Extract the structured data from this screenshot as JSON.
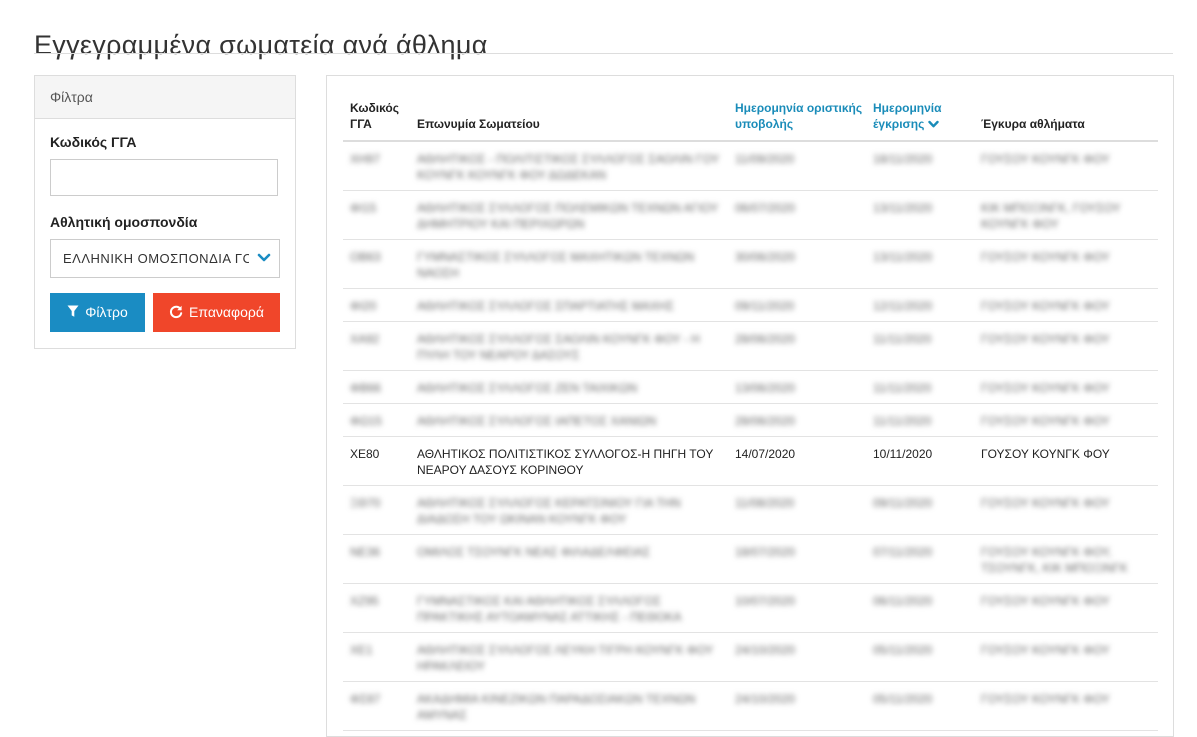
{
  "page": {
    "title": "Εγγεγραμμένα σωματεία ανά άθλημα"
  },
  "filters": {
    "panel_title": "Φίλτρα",
    "gga_code_label": "Κωδικός ΓΓΑ",
    "gga_code_value": "",
    "federation_label": "Αθλητική ομοσπονδία",
    "federation_selected": "ΕΛΛΗΝΙΚΗ ΟΜΟΣΠΟΝΔΙΑ ΓΟΥΣΟΥ",
    "filter_button": "Φίλτρο",
    "reset_button": "Επαναφορά",
    "filter_button_color": "#1a8cc3",
    "reset_button_color": "#f0462a",
    "icons": {
      "filter": "funnel-icon",
      "reset": "refresh-icon",
      "select": "chevron-down-icon"
    }
  },
  "table": {
    "headers": {
      "code": "Κωδικός ΓΓΑ",
      "name": "Επωνυμία Σωματείου",
      "submission_date": "Ημερομηνία οριστικής υποβολής",
      "approval_date": "Ημερομηνία έγκρισης",
      "valid_sports": "Έγκυρα αθλήματα"
    },
    "sorted_by": "approval_date",
    "sort_direction": "descending",
    "link_color": "#1a8cb9",
    "rows": [
      {
        "code": "ΧΗ97",
        "name": "ΑΘΛΗΤΙΚΟΣ - ΠΟΛΙΤΙΣΤΙΚΟΣ ΣΥΛΛΟΓΟΣ ΣΑΟΛΙΝ ΓΟΥ ΚΟΥΝΓΚ ΚΟΥΝΓΚ ΦΟΥ ΔΩΔΕΚΑΝ",
        "submitted": "11/09/2020",
        "approved": "18/11/2020",
        "sports": "ΓΟΥΣΟΥ ΚΟΥΝΓΚ ΦΟΥ",
        "blurred": true,
        "lines": 2
      },
      {
        "code": "ΦΙ15",
        "name": "ΑΘΛΗΤΙΚΟΣ ΣΥΛΛΟΓΟΣ ΠΟΛΕΜΙΚΩΝ ΤΕΧΝΩΝ ΑΓΙΟΥ ΔΗΜΗΤΡΙΟΥ ΚΑΙ ΠΕΡΙΧΩΡΩΝ",
        "submitted": "06/07/2020",
        "approved": "13/11/2020",
        "sports": "ΚΙΚ ΜΠΟΞΙΝΓΚ, ΓΟΥΣΟΥ ΚΟΥΝΓΚ ΦΟΥ",
        "blurred": true,
        "lines": 2
      },
      {
        "code": "ΟΒ63",
        "name": "ΓΥΜΝΑΣΤΙΚΟΣ ΣΥΛΛΟΓΟΣ ΜΑΧΗΤΙΚΩΝ ΤΕΧΝΩΝ ΝΑΟΣΗ",
        "submitted": "30/06/2020",
        "approved": "13/11/2020",
        "sports": "ΓΟΥΣΟΥ ΚΟΥΝΓΚ ΦΟΥ",
        "blurred": true,
        "lines": 2
      },
      {
        "code": "ΦΙ20",
        "name": "ΑΘΛΗΤΙΚΟΣ ΣΥΛΛΟΓΟΣ ΣΠΑΡΤΙΑΤΗΣ ΜΑΧΗΣ",
        "submitted": "09/11/2020",
        "approved": "12/11/2020",
        "sports": "ΓΟΥΣΟΥ ΚΟΥΝΓΚ ΦΟΥ",
        "blurred": true,
        "lines": 1
      },
      {
        "code": "ΧΑ92",
        "name": "ΑΘΛΗΤΙΚΟΣ ΣΥΛΛΟΓΟΣ ΣΑΟΛΙΝ ΚΟΥΝΓΚ ΦΟΥ - Η ΠΥΛΗ ΤΟΥ ΝΕΑΡΟΥ ΔΑΣΟΥΣ",
        "submitted": "28/06/2020",
        "approved": "11/11/2020",
        "sports": "ΓΟΥΣΟΥ ΚΟΥΝΓΚ ΦΟΥ",
        "blurred": true,
        "lines": 2
      },
      {
        "code": "ΦΒ66",
        "name": "ΑΘΛΗΤΙΚΟΣ ΣΥΛΛΟΓΟΣ ΖΕΝ ΤΑΙΧΙΚΩΝ",
        "submitted": "13/06/2020",
        "approved": "11/11/2020",
        "sports": "ΓΟΥΣΟΥ ΚΟΥΝΓΚ ΦΟΥ",
        "blurred": true,
        "lines": 1
      },
      {
        "code": "ΦΩ15",
        "name": "ΑΘΛΗΤΙΚΟΣ ΣΥΛΛΟΓΟΣ ΙΑΠΕΤΟΣ ΧΑΝΙΩΝ",
        "submitted": "28/06/2020",
        "approved": "11/11/2020",
        "sports": "ΓΟΥΣΟΥ ΚΟΥΝΓΚ ΦΟΥ",
        "blurred": true,
        "lines": 1
      },
      {
        "code": "ΧΕ80",
        "name": "ΑΘΛΗΤΙΚΟΣ ΠΟΛΙΤΙΣΤΙΚΟΣ ΣΥΛΛΟΓΟΣ-Η ΠΗΓΗ ΤΟΥ ΝΕΑΡΟΥ ΔΑΣΟΥΣ ΚΟΡΙΝΘΟΥ",
        "submitted": "14/07/2020",
        "approved": "10/11/2020",
        "sports": "ΓΟΥΣΟΥ ΚΟΥΝΓΚ ΦΟΥ",
        "blurred": false,
        "lines": 2
      },
      {
        "code": "ΞΘ70",
        "name": "ΑΘΛΗΤΙΚΟΣ ΣΥΛΛΟΓΟΣ ΚΕΡΑΤΣΙΝΙΟΥ ΓΙΑ ΤΗΝ ΔΙΑΔΟΣΗ ΤΟΥ ΩΚΙΝΑΝ ΚΟΥΝΓΚ ΦΟΥ",
        "submitted": "11/08/2020",
        "approved": "09/11/2020",
        "sports": "ΓΟΥΣΟΥ ΚΟΥΝΓΚ ΦΟΥ",
        "blurred": true,
        "lines": 2
      },
      {
        "code": "ΝΕ36",
        "name": "ΟΜΙΛΟΣ ΤΣΟΥΝΓΚ ΝΕΑΣ ΦΙΛΑΔΕΛΦΕΙΑΣ",
        "submitted": "18/07/2020",
        "approved": "07/11/2020",
        "sports": "ΓΟΥΣΟΥ ΚΟΥΝΓΚ ΦΟΥ, ΤΣΟΥΝΓΚ, ΚΙΚ ΜΠΟΞΙΝΓΚ",
        "blurred": true,
        "lines": 2
      },
      {
        "code": "ΧΖ95",
        "name": "ΓΥΜΝΑΣΤΙΚΟΣ ΚΑΙ ΑΘΛΗΤΙΚΟΣ ΣΥΛΛΟΓΟΣ ΠΡΑΚΤΙΚΗΣ ΑΥΤΟΑΜΥΝΑΣ ΑΤΤΙΚΗΣ - ΠΕΘΟΚΑ",
        "submitted": "10/07/2020",
        "approved": "06/11/2020",
        "sports": "ΓΟΥΣΟΥ ΚΟΥΝΓΚ ΦΟΥ",
        "blurred": true,
        "lines": 2
      },
      {
        "code": "ΧΕ1",
        "name": "ΑΘΛΗΤΙΚΟΣ ΣΥΛΛΟΓΟΣ ΛΕΥΚΗ ΤΙΓΡΗ ΚΟΥΝΓΚ ΦΟΥ ΗΡΑΚΛΕΙΟΥ",
        "submitted": "24/10/2020",
        "approved": "05/11/2020",
        "sports": "ΓΟΥΣΟΥ ΚΟΥΝΓΚ ΦΟΥ",
        "blurred": true,
        "lines": 2
      },
      {
        "code": "ΦΣ87",
        "name": "ΑΚΑΔΗΜΙΑ ΚΙΝΕΖΙΚΩΝ ΠΑΡΑΔΟΣΙΑΚΩΝ ΤΕΧΝΩΝ ΑΜΥΝΑΣ",
        "submitted": "24/10/2020",
        "approved": "05/11/2020",
        "sports": "ΓΟΥΣΟΥ ΚΟΥΝΓΚ ΦΟΥ",
        "blurred": true,
        "lines": 2
      }
    ]
  }
}
